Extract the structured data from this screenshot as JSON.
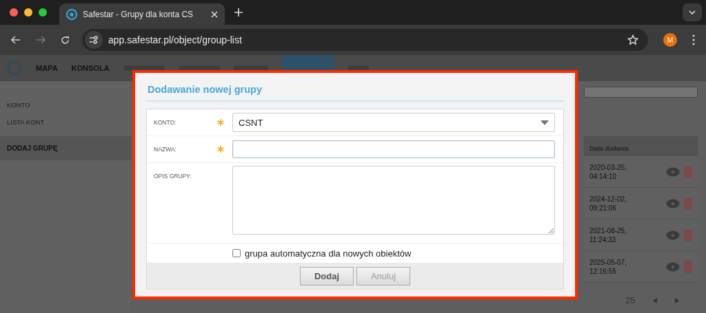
{
  "browser": {
    "tab_title": "Safestar - Grupy dla konta CS",
    "url": "app.safestar.pl/object/group-list",
    "profile_initial": "M"
  },
  "app": {
    "nav": [
      "MAPA",
      "KONSOLA"
    ],
    "sidebar": [
      {
        "label": "KONTO",
        "selected": false
      },
      {
        "label": "LISTA KONT",
        "selected": false
      },
      {
        "label": "DODAJ GRUPĘ",
        "selected": true
      }
    ],
    "table": {
      "column_header": "Data dodania",
      "rows": [
        {
          "date": "2020-03-25,",
          "time": "04:14:10"
        },
        {
          "date": "2024-12-02,",
          "time": "09:21:06"
        },
        {
          "date": "2021-08-25,",
          "time": "11:24:33"
        },
        {
          "date": "2025-05-07,",
          "time": "12:16:55"
        }
      ]
    },
    "pager": {
      "page_size": "25"
    }
  },
  "dialog": {
    "title": "Dodawanie nowej grupy",
    "fields": [
      {
        "kind": "select",
        "label": "KONTO:",
        "required": true,
        "value": "CSNT"
      },
      {
        "kind": "text",
        "label": "NAZWA:",
        "required": true
      },
      {
        "kind": "textarea",
        "label": "OPIS GRUPY:",
        "required": false
      }
    ],
    "checkbox": {
      "label": "grupa automatyczna dla nowych obiektów",
      "checked": false
    },
    "buttons": [
      {
        "label": "Dodaj",
        "disabled": false
      },
      {
        "label": "Anuluj",
        "disabled": true
      }
    ]
  }
}
